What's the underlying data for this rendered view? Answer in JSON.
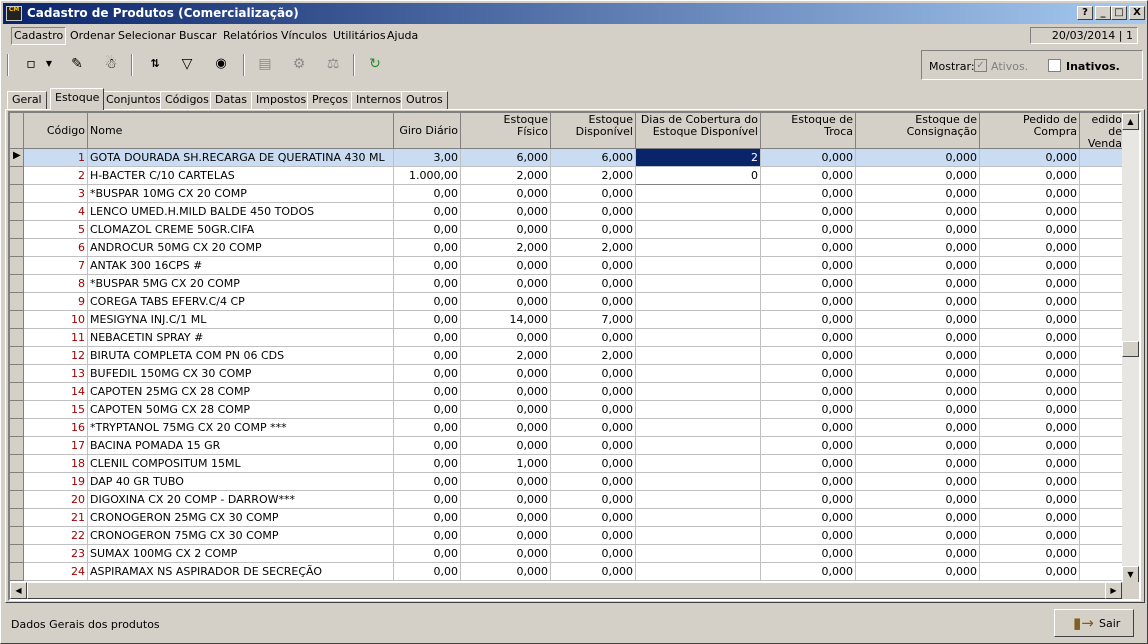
{
  "window": {
    "title": "Cadastro de Produtos (Comercialização)",
    "app_icon_text": "CM"
  },
  "title_buttons": [
    "?",
    "_",
    "□",
    "X"
  ],
  "menu": [
    "Cadastro",
    "Ordenar",
    "Selecionar",
    "Buscar",
    "Relatórios",
    "Vínculos",
    "Utilitários",
    "Ajuda"
  ],
  "date_field": "20/03/2014 | 1",
  "toolbar": {
    "icons": [
      "new-icon",
      "dropdown-arrow-icon",
      "edit-record-icon",
      "delete-icon",
      "sort-az-icon",
      "filter-icon",
      "search-binoculars-icon",
      "form-view-icon",
      "settings-icon",
      "scale-icon",
      "refresh-icon"
    ]
  },
  "filter": {
    "label": "Mostrar:",
    "ativos": "Ativos.",
    "inativos": "Inativos.",
    "ativos_checked": true,
    "inativos_checked": false
  },
  "tabs": [
    "Geral",
    "Estoque",
    "Conjuntos",
    "Códigos",
    "Datas",
    "Impostos",
    "Preços",
    "Internos",
    "Outros"
  ],
  "active_tab": "Estoque",
  "grid": {
    "columns": [
      "Código",
      "Nome",
      "Giro Diário",
      "Estoque\nFísico",
      "Estoque\nDisponível",
      "Dias de Cobertura do\nEstoque Disponível",
      "Estoque de\nTroca",
      "Estoque de\nConsignação",
      "Pedido de\nCompra",
      "edido de\nVenda"
    ],
    "rows": [
      [
        "1",
        "GOTA DOURADA SH.RECARGA DE QUERATINA 430 ML",
        "3,00",
        "6,000",
        "6,000",
        "2",
        "0,000",
        "0,000",
        "0,000",
        ""
      ],
      [
        "2",
        "H-BACTER C/10 CARTELAS",
        "1.000,00",
        "2,000",
        "2,000",
        "0",
        "0,000",
        "0,000",
        "0,000",
        ""
      ],
      [
        "3",
        "*BUSPAR 10MG CX 20 COMP",
        "0,00",
        "0,000",
        "0,000",
        "",
        "0,000",
        "0,000",
        "0,000",
        ""
      ],
      [
        "4",
        "LENCO UMED.H.MILD BALDE 450 TODOS",
        "0,00",
        "0,000",
        "0,000",
        "",
        "0,000",
        "0,000",
        "0,000",
        ""
      ],
      [
        "5",
        "CLOMAZOL CREME 50GR.CIFA",
        "0,00",
        "0,000",
        "0,000",
        "",
        "0,000",
        "0,000",
        "0,000",
        ""
      ],
      [
        "6",
        "ANDROCUR 50MG CX 20 COMP",
        "0,00",
        "2,000",
        "2,000",
        "",
        "0,000",
        "0,000",
        "0,000",
        ""
      ],
      [
        "7",
        "ANTAK 300 16CPS #",
        "0,00",
        "0,000",
        "0,000",
        "",
        "0,000",
        "0,000",
        "0,000",
        ""
      ],
      [
        "8",
        "*BUSPAR 5MG CX 20 COMP",
        "0,00",
        "0,000",
        "0,000",
        "",
        "0,000",
        "0,000",
        "0,000",
        ""
      ],
      [
        "9",
        "COREGA TABS EFERV.C/4 CP",
        "0,00",
        "0,000",
        "0,000",
        "",
        "0,000",
        "0,000",
        "0,000",
        ""
      ],
      [
        "10",
        "MESIGYNA INJ.C/1 ML",
        "0,00",
        "14,000",
        "7,000",
        "",
        "0,000",
        "0,000",
        "0,000",
        ""
      ],
      [
        "11",
        "NEBACETIN SPRAY #",
        "0,00",
        "0,000",
        "0,000",
        "",
        "0,000",
        "0,000",
        "0,000",
        ""
      ],
      [
        "12",
        "BIRUTA COMPLETA COM PN 06  CDS",
        "0,00",
        "2,000",
        "2,000",
        "",
        "0,000",
        "0,000",
        "0,000",
        ""
      ],
      [
        "13",
        "BUFEDIL 150MG CX 30 COMP",
        "0,00",
        "0,000",
        "0,000",
        "",
        "0,000",
        "0,000",
        "0,000",
        ""
      ],
      [
        "14",
        "CAPOTEN 25MG CX 28 COMP",
        "0,00",
        "0,000",
        "0,000",
        "",
        "0,000",
        "0,000",
        "0,000",
        ""
      ],
      [
        "15",
        "CAPOTEN 50MG CX 28 COMP",
        "0,00",
        "0,000",
        "0,000",
        "",
        "0,000",
        "0,000",
        "0,000",
        ""
      ],
      [
        "16",
        "*TRYPTANOL 75MG CX 20 COMP ***",
        "0,00",
        "0,000",
        "0,000",
        "",
        "0,000",
        "0,000",
        "0,000",
        ""
      ],
      [
        "17",
        "BACINA POMADA 15 GR",
        "0,00",
        "0,000",
        "0,000",
        "",
        "0,000",
        "0,000",
        "0,000",
        ""
      ],
      [
        "18",
        "CLENIL COMPOSITUM 15ML",
        "0,00",
        "1,000",
        "0,000",
        "",
        "0,000",
        "0,000",
        "0,000",
        ""
      ],
      [
        "19",
        "DAP 40 GR TUBO",
        "0,00",
        "0,000",
        "0,000",
        "",
        "0,000",
        "0,000",
        "0,000",
        ""
      ],
      [
        "20",
        "DIGOXINA CX 20 COMP - DARROW***",
        "0,00",
        "0,000",
        "0,000",
        "",
        "0,000",
        "0,000",
        "0,000",
        ""
      ],
      [
        "21",
        "CRONOGERON 25MG CX 30 COMP",
        "0,00",
        "0,000",
        "0,000",
        "",
        "0,000",
        "0,000",
        "0,000",
        ""
      ],
      [
        "22",
        "CRONOGERON 75MG CX 30 COMP",
        "0,00",
        "0,000",
        "0,000",
        "",
        "0,000",
        "0,000",
        "0,000",
        ""
      ],
      [
        "23",
        "SUMAX 100MG CX 2 COMP",
        "0,00",
        "0,000",
        "0,000",
        "",
        "0,000",
        "0,000",
        "0,000",
        ""
      ],
      [
        "24",
        "ASPIRAMAX NS ASPIRADOR DE SECREÇÃO",
        "0,00",
        "0,000",
        "0,000",
        "",
        "0,000",
        "0,000",
        "0,000",
        ""
      ]
    ]
  },
  "status": {
    "text": "Dados Gerais dos produtos",
    "exit_label": "Sair"
  },
  "colors": {
    "title_start": "#0a246a",
    "title_end": "#a6caf0",
    "selected_row": "#c9dcf2",
    "code_text": "#a00000",
    "grid_cell_edit": "#0a246a"
  }
}
